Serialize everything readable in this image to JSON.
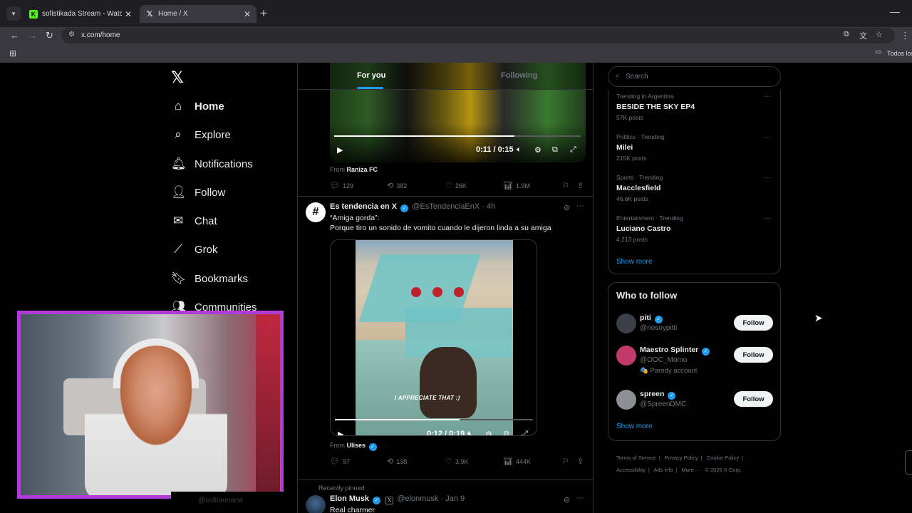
{
  "browser": {
    "tabs": [
      {
        "title": "sofistikada Stream - Watch Live",
        "favicon": "kick-icon"
      },
      {
        "title": "Home / X",
        "favicon": "x-logo-icon"
      }
    ],
    "url": "x.com/home",
    "bookmarks_folder": "Todos los"
  },
  "nav": {
    "items": [
      {
        "label": "Home",
        "icon": "home-icon"
      },
      {
        "label": "Explore",
        "icon": "search-icon"
      },
      {
        "label": "Notifications",
        "icon": "bell-icon"
      },
      {
        "label": "Follow",
        "icon": "person-add-icon"
      },
      {
        "label": "Chat",
        "icon": "envelope-icon"
      },
      {
        "label": "Grok",
        "icon": "grok-icon"
      },
      {
        "label": "Bookmarks",
        "icon": "bookmark-icon"
      },
      {
        "label": "Communities",
        "icon": "communities-icon"
      }
    ],
    "partial_handle": "@sofitareview"
  },
  "feed": {
    "tab_for_you": "For you",
    "tab_following": "Following",
    "post1": {
      "time": "0:11 / 0:15",
      "progress": 0.73,
      "from_label": "From",
      "from_name": "Raniza FC",
      "replies": "129",
      "reposts": "382",
      "likes": "26K",
      "views": "1.9M"
    },
    "post2": {
      "name": "Es tendencia en X",
      "handle": "@EsTendenciaEnX",
      "time_ago": "4h",
      "line1": "“Amiga gorda”:",
      "line2": "Porque tiro un sonido de vomito cuando le dijeron linda a su amiga",
      "caption": "I APPRECIATE THAT :)",
      "video_time": "0:12 / 0:19",
      "progress": 0.63,
      "from_label": "From",
      "from_name": "Ulises",
      "replies": "97",
      "reposts": "138",
      "likes": "3.9K",
      "views": "444K"
    },
    "pinned": {
      "label": "Recently pinned",
      "name": "Elon Musk",
      "handle": "@elonmusk",
      "date": "Jan 9",
      "text": "Real charmer"
    }
  },
  "sidebar": {
    "search_placeholder": "Search",
    "trends": [
      {
        "context": "Trending in Argentina",
        "name": "BESIDE THE SKY EP4",
        "posts": "57K posts"
      },
      {
        "context": "Politics · Trending",
        "name": "Milei",
        "posts": "215K posts"
      },
      {
        "context": "Sports · Trending",
        "name": "Macclesfield",
        "posts": "46.6K posts"
      },
      {
        "context": "Entertainment · Trending",
        "name": "Luciano Castro",
        "posts": "4,213 posts"
      }
    ],
    "trends_show_more": "Show more",
    "who_to_follow_title": "Who to follow",
    "who_to_follow": [
      {
        "name": "piti",
        "handle": "@nosoypitti",
        "extra": "",
        "avatar_color": "#3a3f48"
      },
      {
        "name": "Maestro Splinter",
        "handle": "@OOC_Momo",
        "extra": "🎭 Parody account",
        "avatar_color": "#c23a6a"
      },
      {
        "name": "spreen",
        "handle": "@SpreenDMC",
        "extra": "",
        "avatar_color": "#8c8f94"
      }
    ],
    "follow_label": "Follow",
    "wtf_show_more": "Show more",
    "footer": [
      "Terms of Service",
      "|",
      "Privacy Policy",
      "|",
      "Cookie Policy",
      "|",
      "Accessibility",
      "|",
      "Ads info",
      "|",
      "More ···",
      "© 2026 X Corp."
    ]
  },
  "colors": {
    "accent": "#1d9bf0",
    "webcam_border": "#b03bd8"
  }
}
